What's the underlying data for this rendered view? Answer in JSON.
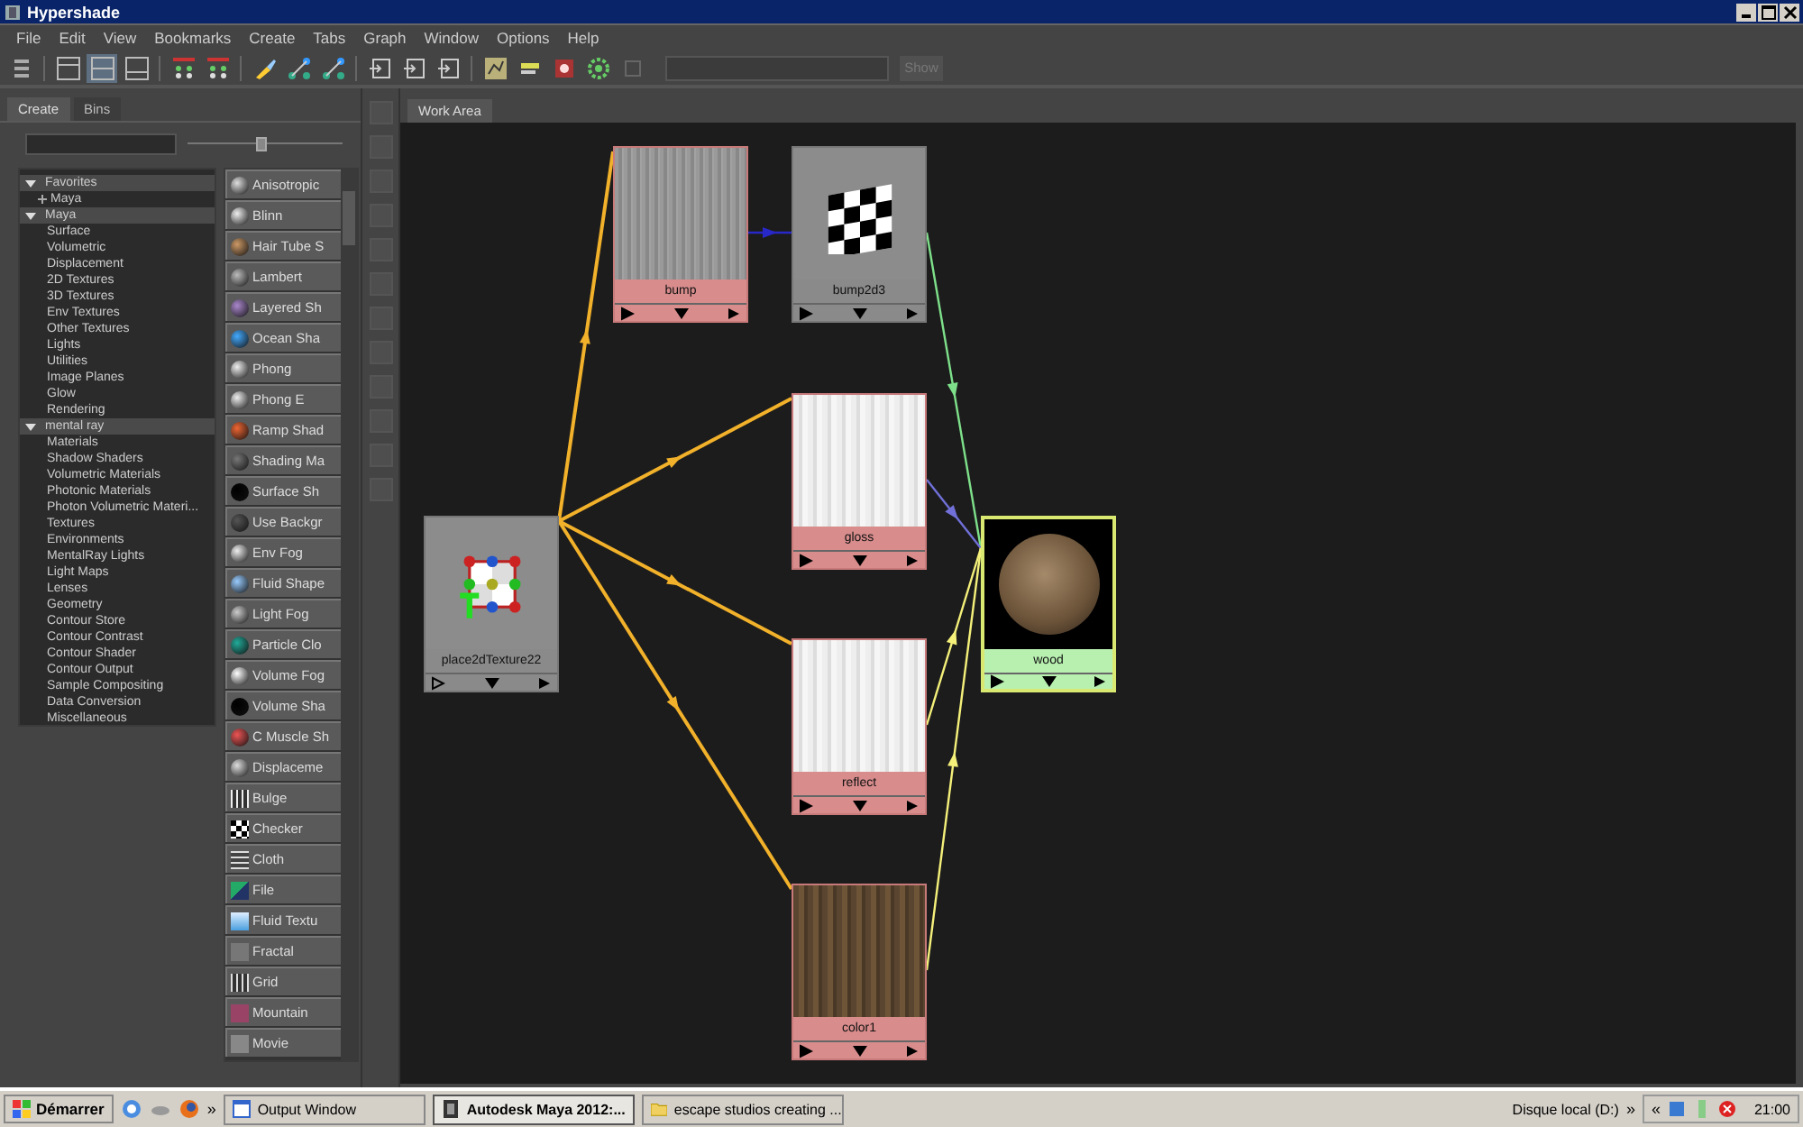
{
  "window": {
    "title": "Hypershade"
  },
  "menu": [
    "File",
    "Edit",
    "View",
    "Bookmarks",
    "Create",
    "Tabs",
    "Graph",
    "Window",
    "Options",
    "Help"
  ],
  "toolbar_layouts": [
    {
      "selected": false
    },
    {
      "selected": true
    },
    {
      "selected": false
    }
  ],
  "show_button": {
    "label": "Show",
    "disabled": true
  },
  "panel_tabs": [
    {
      "label": "Create",
      "selected": true
    },
    {
      "label": "Bins",
      "selected": false
    }
  ],
  "icon_size_slider": {
    "level": 0.48
  },
  "tree": [
    {
      "label": "Favorites",
      "expanded": true,
      "children": [
        {
          "label": "Maya",
          "expanded": false
        }
      ]
    },
    {
      "label": "Maya",
      "expanded": true,
      "children": [
        {
          "label": "Surface"
        },
        {
          "label": "Volumetric"
        },
        {
          "label": "Displacement"
        },
        {
          "label": "2D Textures"
        },
        {
          "label": "3D Textures"
        },
        {
          "label": "Env Textures"
        },
        {
          "label": "Other Textures"
        },
        {
          "label": "Lights"
        },
        {
          "label": "Utilities"
        },
        {
          "label": "Image Planes"
        },
        {
          "label": "Glow"
        },
        {
          "label": "Rendering"
        }
      ]
    },
    {
      "label": "mental ray",
      "expanded": true,
      "children": [
        {
          "label": "Materials"
        },
        {
          "label": "Shadow Shaders"
        },
        {
          "label": "Volumetric Materials"
        },
        {
          "label": "Photonic Materials"
        },
        {
          "label": "Photon Volumetric Materi..."
        },
        {
          "label": "Textures"
        },
        {
          "label": "Environments"
        },
        {
          "label": "MentalRay Lights"
        },
        {
          "label": "Light Maps"
        },
        {
          "label": "Lenses"
        },
        {
          "label": "Geometry"
        },
        {
          "label": "Contour Store"
        },
        {
          "label": "Contour Contrast"
        },
        {
          "label": "Contour Shader"
        },
        {
          "label": "Contour Output"
        },
        {
          "label": "Sample Compositing"
        },
        {
          "label": "Data Conversion"
        },
        {
          "label": "Miscellaneous"
        }
      ]
    }
  ],
  "node_buttons": [
    "Anisotropic",
    "Blinn",
    "Hair Tube S",
    "Lambert",
    "Layered Sh",
    "Ocean Sha",
    "Phong",
    "Phong E",
    "Ramp Shad",
    "Shading Ma",
    "Surface Sh",
    "Use Backgr",
    "Env Fog",
    "Fluid Shape",
    "Light Fog",
    "Particle Clo",
    "Volume Fog",
    "Volume Sha",
    "C Muscle Sh",
    "Displaceme",
    "Bulge",
    "Checker",
    "Cloth",
    "File",
    "Fluid Textu",
    "Fractal",
    "Grid",
    "Mountain",
    "Movie"
  ],
  "work_area_tab": {
    "label": "Work Area",
    "selected": true
  },
  "nodes": [
    {
      "name": "place2dTexture22",
      "kind": "utility",
      "selected": false
    },
    {
      "name": "bump",
      "kind": "texture",
      "selected": false
    },
    {
      "name": "bump2d3",
      "kind": "utility",
      "selected": false
    },
    {
      "name": "gloss",
      "kind": "texture",
      "selected": false
    },
    {
      "name": "reflect",
      "kind": "texture",
      "selected": false
    },
    {
      "name": "color1",
      "kind": "texture",
      "selected": false
    },
    {
      "name": "wood",
      "kind": "material",
      "selected": true
    }
  ],
  "connections": [
    {
      "color": "#f2b12a"
    },
    {
      "color": "#f2b12a"
    },
    {
      "color": "#f2b12a"
    },
    {
      "color": "#f2b12a"
    },
    {
      "color": "#2828c8"
    },
    {
      "color": "#7ee08a"
    },
    {
      "color": "#7070d8"
    },
    {
      "color": "#f4f07a"
    },
    {
      "color": "#f4f07a"
    }
  ],
  "taskbar": {
    "start": "Démarrer",
    "more": "»",
    "tasks": [
      {
        "label": "Output Window",
        "selected": false
      },
      {
        "label": "Autodesk Maya 2012:...",
        "selected": true
      },
      {
        "label": "escape studios creating ...",
        "selected": false
      }
    ],
    "drive": "Disque local (D:)",
    "tray_more": "»",
    "tray_collapse": "«",
    "clock": "21:00"
  }
}
